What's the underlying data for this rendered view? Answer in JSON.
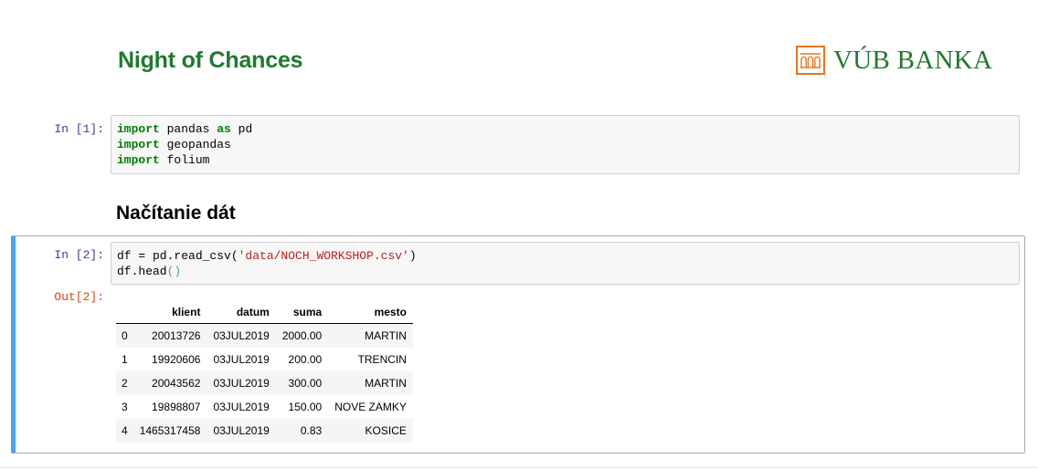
{
  "header": {
    "title": "Night of Chances",
    "logo_text": "VÚB BANKA"
  },
  "colors": {
    "brand_green": "#1f7a2e",
    "logo_orange": "#e8741e",
    "selected_cell": "#42a5f5",
    "prompt_in": "#303f9f",
    "prompt_out": "#d84315"
  },
  "cells": [
    {
      "prompt": "In [1]:",
      "lines": [
        [
          {
            "t": "import",
            "c": "kw"
          },
          {
            "t": " pandas ",
            "c": ""
          },
          {
            "t": "as",
            "c": "kw"
          },
          {
            "t": " pd",
            "c": ""
          }
        ],
        [
          {
            "t": "import",
            "c": "kw"
          },
          {
            "t": " geopandas",
            "c": ""
          }
        ],
        [
          {
            "t": "import",
            "c": "kw"
          },
          {
            "t": " folium",
            "c": ""
          }
        ]
      ]
    },
    {
      "prompt": "In [2]:",
      "lines": [
        [
          {
            "t": "df = pd.read_csv(",
            "c": ""
          },
          {
            "t": "'data/NOCH_WORKSHOP.csv'",
            "c": "str"
          },
          {
            "t": ")",
            "c": ""
          }
        ],
        [
          {
            "t": "df.head",
            "c": ""
          },
          {
            "t": "()",
            "c": "paren"
          }
        ]
      ]
    }
  ],
  "section_heading": "Načítanie dát",
  "output": {
    "prompt": "Out[2]:",
    "columns": [
      "",
      "klient",
      "datum",
      "suma",
      "mesto"
    ],
    "rows": [
      [
        "0",
        "20013726",
        "03JUL2019",
        "2000.00",
        "MARTIN"
      ],
      [
        "1",
        "19920606",
        "03JUL2019",
        "200.00",
        "TRENCIN"
      ],
      [
        "2",
        "20043562",
        "03JUL2019",
        "300.00",
        "MARTIN"
      ],
      [
        "3",
        "19898807",
        "03JUL2019",
        "150.00",
        "NOVE ZAMKY"
      ],
      [
        "4",
        "1465317458",
        "03JUL2019",
        "0.83",
        "KOSICE"
      ]
    ]
  }
}
